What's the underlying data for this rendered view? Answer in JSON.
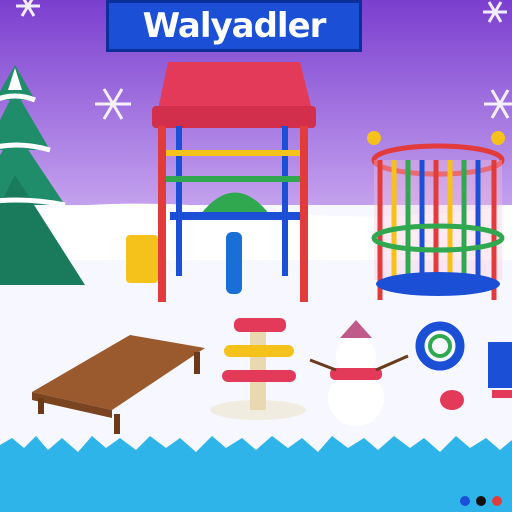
{
  "banner": {
    "title": "Walyadler"
  },
  "colors": {
    "sky_top": "#7b3fcf",
    "sky_bottom": "#c9a8f0",
    "snow": "#f7f8ff",
    "banner_bg": "#1a4fd6",
    "ice_band": "#2fb4ea",
    "tree": "#1f8c6a",
    "playhouse_roof": "#e43a5a",
    "playground_frame": "#e23b3b",
    "bench": "#9a5a2e"
  },
  "scene_items": [
    "christmas-tree",
    "playhouse",
    "round-play-pen",
    "wooden-bench",
    "ring-stacker-toy",
    "snowman",
    "ring-toy",
    "blue-machine-toy"
  ],
  "pagination_dots": [
    "#1a4fd6",
    "#111111",
    "#e23b3b"
  ]
}
